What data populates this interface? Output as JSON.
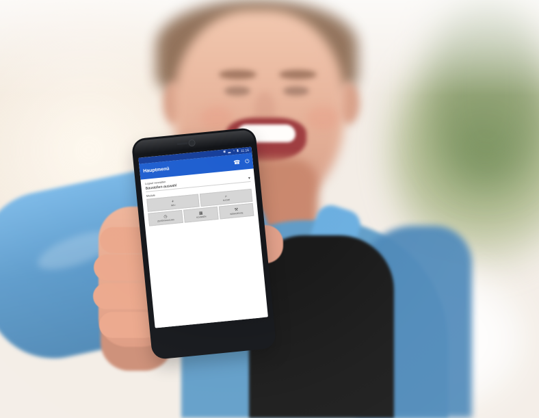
{
  "photo": {
    "phone": {
      "status_bar": {
        "icons": [
          "bluetooth-icon",
          "signal-icon",
          "wifi-icon",
          "battery-icon"
        ],
        "time": "11:16"
      },
      "app": {
        "title": "Hauptmenü",
        "action_icons": [
          "phone-icon",
          "settings-icon"
        ],
        "field_label": "Logout verwalten",
        "field_value": "Baustellen-auswahl",
        "section_label": "Module",
        "buttons_top": [
          {
            "label": "NEU",
            "icon": "add-icon"
          },
          {
            "label": "SUCHE",
            "icon": "search-icon"
          }
        ],
        "buttons_bottom": [
          {
            "label": "ZEITERFASSUNG",
            "icon": "clock-icon"
          },
          {
            "label": "SCANNEN",
            "icon": "scan-icon"
          },
          {
            "label": "WERKZEUGE",
            "icon": "tool-icon"
          }
        ]
      }
    }
  }
}
